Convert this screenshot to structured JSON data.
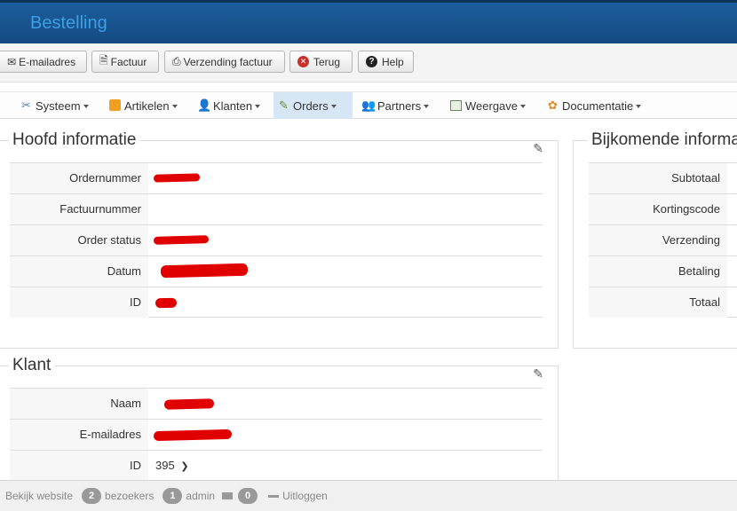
{
  "window": {
    "title": "Bestelling"
  },
  "toolbar": {
    "email_label": "E-mailadres",
    "invoice_label": "Factuur",
    "shipping_invoice_label": "Verzending factuur",
    "back_label": "Terug",
    "help_label": "Help"
  },
  "menu": {
    "items": [
      {
        "label": "Systeem",
        "icon": "tools-icon"
      },
      {
        "label": "Artikelen",
        "icon": "box-icon"
      },
      {
        "label": "Klanten",
        "icon": "users-icon"
      },
      {
        "label": "Orders",
        "icon": "orders-icon",
        "active": true
      },
      {
        "label": "Partners",
        "icon": "partners-icon"
      },
      {
        "label": "Weergave",
        "icon": "layout-icon"
      },
      {
        "label": "Documentatie",
        "icon": "lifebuoy-icon"
      }
    ]
  },
  "main_info": {
    "title": "Hoofd informatie",
    "rows": [
      {
        "label": "Ordernummer",
        "value": ""
      },
      {
        "label": "Factuurnummer",
        "value": ""
      },
      {
        "label": "Order status",
        "value": ""
      },
      {
        "label": "Datum",
        "value": ""
      },
      {
        "label": "ID",
        "value": ""
      }
    ]
  },
  "extra_info": {
    "title": "Bijkomende informa",
    "rows": [
      {
        "label": "Subtotaal"
      },
      {
        "label": "Kortingscode"
      },
      {
        "label": "Verzending"
      },
      {
        "label": "Betaling"
      },
      {
        "label": "Totaal"
      }
    ]
  },
  "customer": {
    "title": "Klant",
    "rows": [
      {
        "label": "Naam",
        "value": ""
      },
      {
        "label": "E-mailadres",
        "value": ""
      },
      {
        "label": "ID",
        "value": "395"
      }
    ]
  },
  "footer": {
    "view_website": "Bekijk website",
    "visitors_count": "2",
    "visitors_label": "bezoekers",
    "admin_count": "1",
    "admin_label": "admin",
    "messages_count": "0",
    "logout_label": "Uitloggen"
  },
  "colors": {
    "header_bg": "#1a5490",
    "title_text": "#3ba0e6",
    "redaction": "#e00000",
    "active_menu": "#d6e6f5"
  }
}
